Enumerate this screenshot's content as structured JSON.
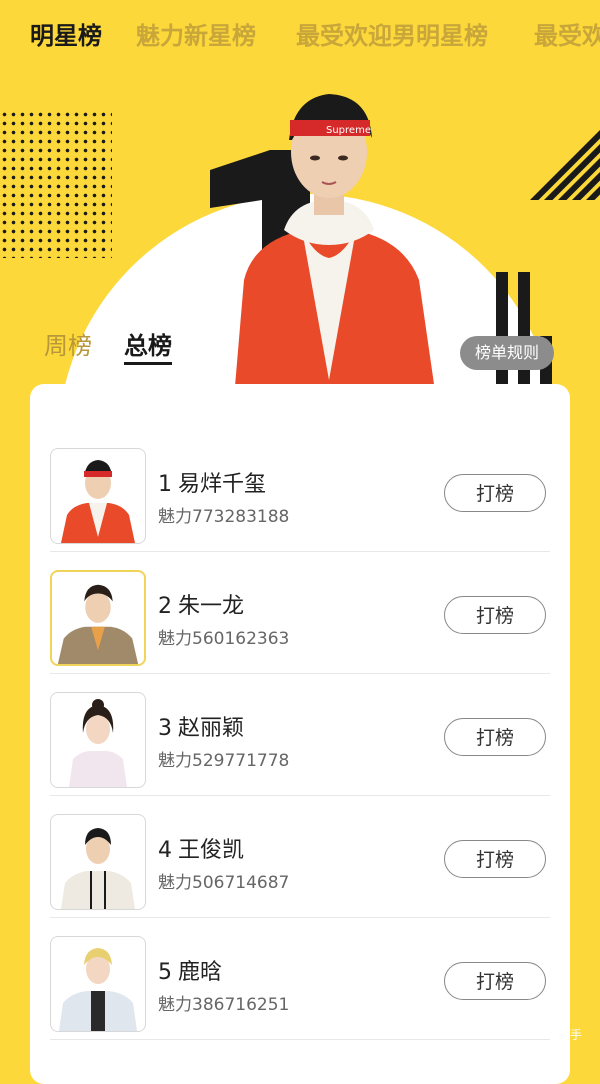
{
  "top_tabs": [
    "明星榜",
    "魅力新星榜",
    "最受欢迎男明星榜",
    "最受欢迎"
  ],
  "sub_tabs": {
    "week": "周榜",
    "total": "总榜"
  },
  "rules_button": "榜单规则",
  "rank_list": [
    {
      "rank": "1",
      "name": "易烊千玺",
      "charm": "魅力773283188",
      "button": "打榜",
      "shirt_color": "#e84a2a"
    },
    {
      "rank": "2",
      "name": "朱一龙",
      "charm": "魅力560162363",
      "button": "打榜",
      "shirt_color": "#a08a6a"
    },
    {
      "rank": "3",
      "name": "赵丽颖",
      "charm": "魅力529771778",
      "button": "打榜",
      "shirt_color": "#f2e6ee"
    },
    {
      "rank": "4",
      "name": "王俊凯",
      "charm": "魅力506714687",
      "button": "打榜",
      "shirt_color": "#eeeae2"
    },
    {
      "rank": "5",
      "name": "鹿晗",
      "charm": "魅力386716251",
      "button": "打榜",
      "shirt_color": "#dfe6ee"
    }
  ],
  "watermark": "手",
  "colors": {
    "background": "#fdd83a",
    "accent_text": "#1a1a1a",
    "inactive_tab": "#c8a63a"
  }
}
